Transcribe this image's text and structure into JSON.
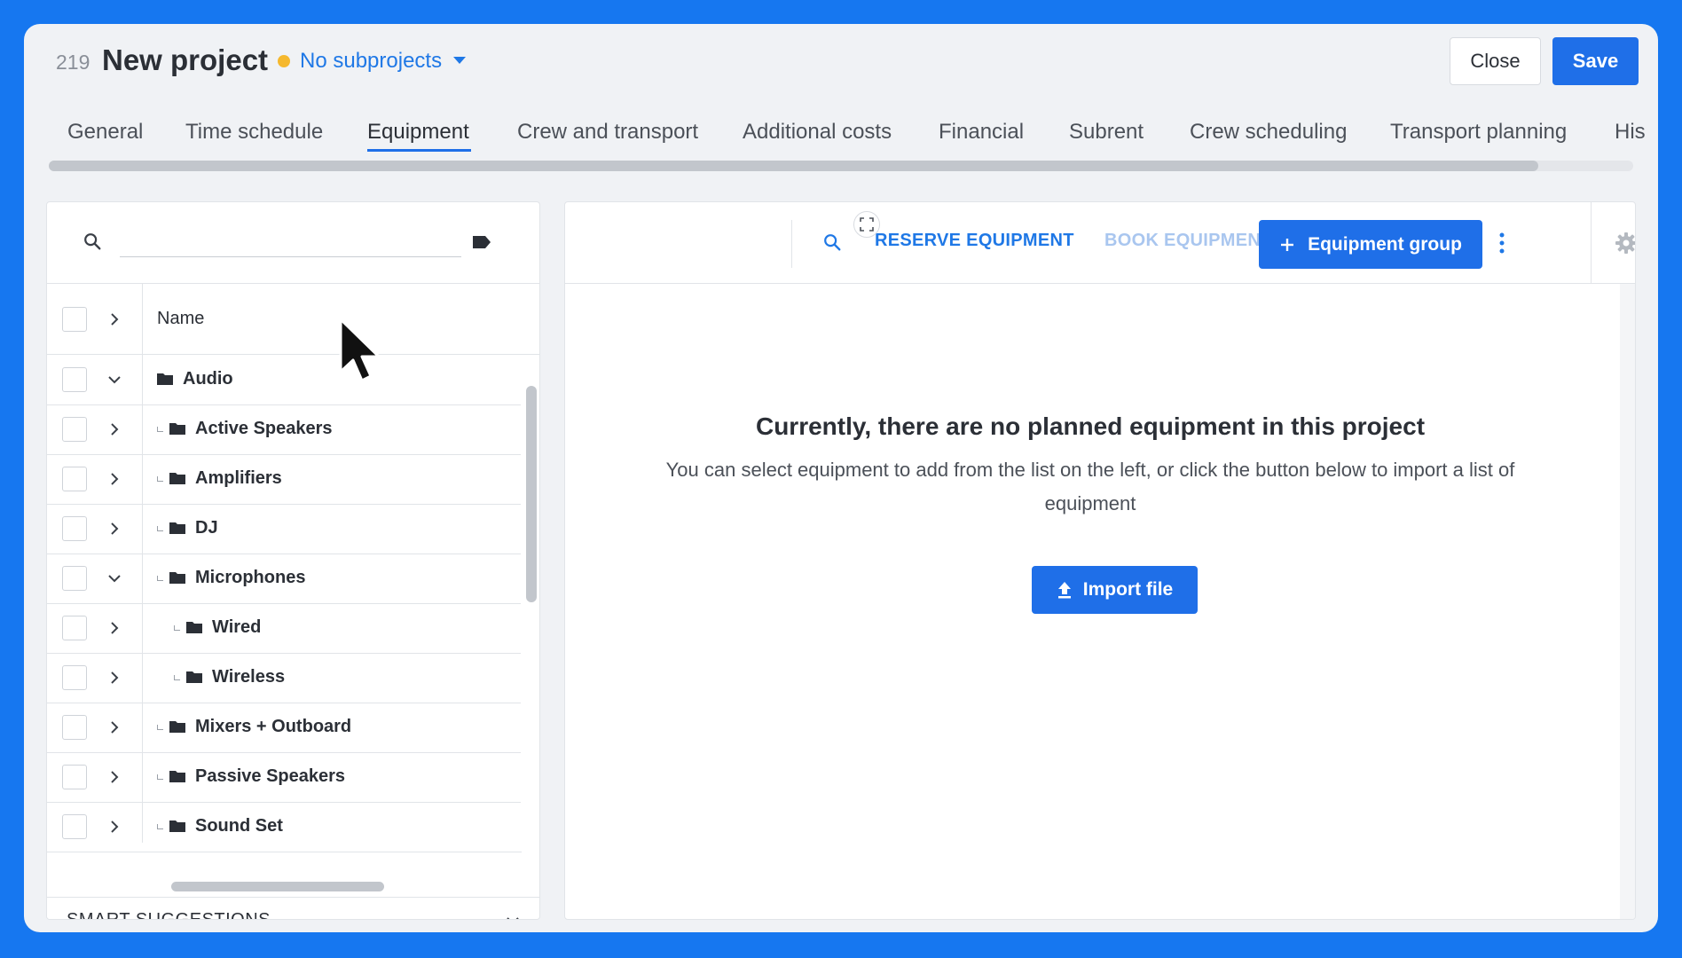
{
  "header": {
    "project_number": "219",
    "project_title": "New project",
    "subprojects_label": "No subprojects",
    "close_label": "Close",
    "save_label": "Save"
  },
  "tabs": [
    {
      "label": "General"
    },
    {
      "label": "Time schedule"
    },
    {
      "label": "Equipment",
      "active": true
    },
    {
      "label": "Crew and transport"
    },
    {
      "label": "Additional costs"
    },
    {
      "label": "Financial"
    },
    {
      "label": "Subrent"
    },
    {
      "label": "Crew scheduling"
    },
    {
      "label": "Transport planning"
    },
    {
      "label": "His"
    }
  ],
  "left_panel": {
    "search_value": "",
    "column_name": "Name",
    "rows": [
      {
        "label": "Audio",
        "expanded": true
      },
      {
        "label": "Active Speakers"
      },
      {
        "label": "Amplifiers"
      },
      {
        "label": "DJ"
      },
      {
        "label": "Microphones",
        "expanded": true
      },
      {
        "label": "Wired"
      },
      {
        "label": "Wireless"
      },
      {
        "label": "Mixers + Outboard"
      },
      {
        "label": "Passive Speakers"
      },
      {
        "label": "Sound Set"
      }
    ],
    "smart_suggestions_label": "SMART SUGGESTIONS"
  },
  "right_panel": {
    "reserve_label": "RESERVE EQUIPMENT",
    "book_label": "BOOK EQUIPMENT",
    "equipment_group_label": "Equipment group",
    "empty_title": "Currently, there are no planned equipment in this project",
    "empty_description": "You can select equipment to add from the list on the left, or click the button below to import a list of equipment",
    "import_label": "Import file"
  },
  "colors": {
    "accent": "#1f6fe8",
    "link": "#1f78e6",
    "status_dot": "#f5b82e",
    "background": "#1677f0"
  },
  "icons": [
    "search-icon",
    "tag-icon",
    "chevron-right-icon",
    "chevron-down-icon",
    "folder-icon",
    "plus-icon",
    "kebab-menu-icon",
    "gear-icon",
    "upload-icon",
    "fullscreen-icon",
    "mouse-pointer-icon"
  ]
}
